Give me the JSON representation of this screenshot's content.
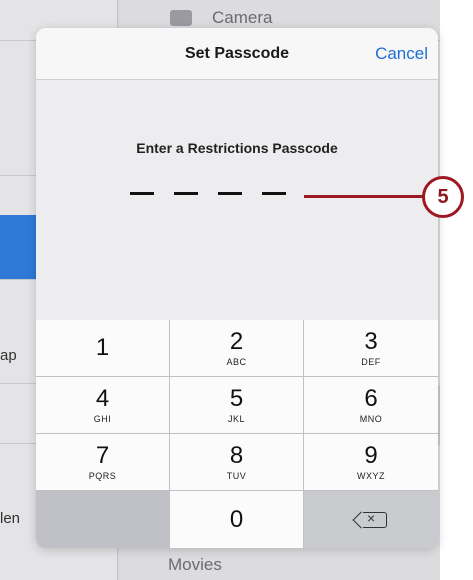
{
  "background": {
    "top_item": "Camera",
    "bottom_item": "Movies",
    "left_fragment_1": "ap",
    "left_fragment_2": "len"
  },
  "modal": {
    "title": "Set Passcode",
    "cancel_label": "Cancel",
    "prompt": "Enter a Restrictions Passcode",
    "digit_slots": 4
  },
  "keypad": {
    "keys": [
      {
        "num": "1",
        "letters": ""
      },
      {
        "num": "2",
        "letters": "ABC"
      },
      {
        "num": "3",
        "letters": "DEF"
      },
      {
        "num": "4",
        "letters": "GHI"
      },
      {
        "num": "5",
        "letters": "JKL"
      },
      {
        "num": "6",
        "letters": "MNO"
      },
      {
        "num": "7",
        "letters": "PQRS"
      },
      {
        "num": "8",
        "letters": "TUV"
      },
      {
        "num": "9",
        "letters": "WXYZ"
      },
      {
        "num": "0",
        "letters": ""
      }
    ],
    "delete_icon": "delete-backspace-icon"
  },
  "callout": {
    "label": "5",
    "color": "#9e1a22"
  }
}
